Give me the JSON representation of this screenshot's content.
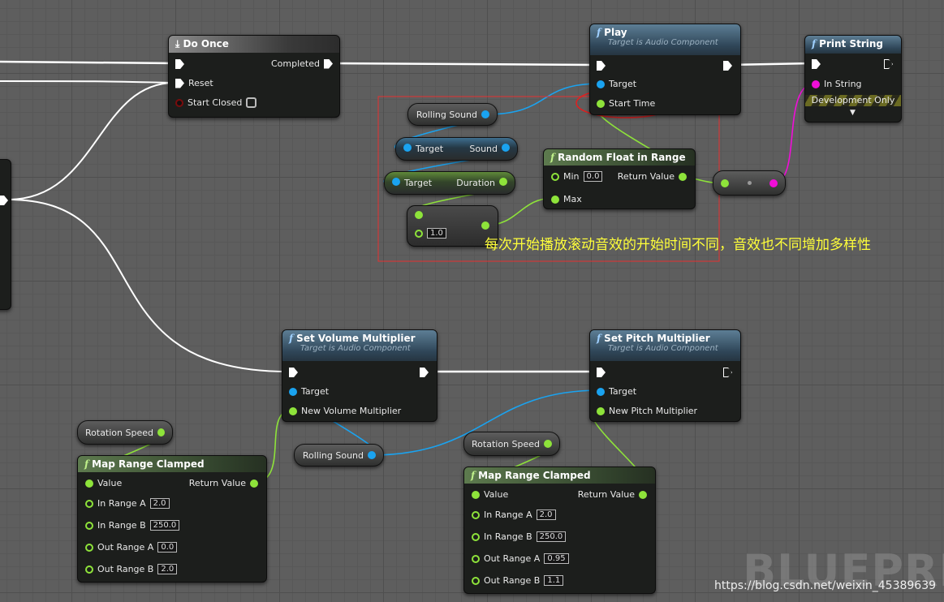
{
  "colors": {
    "exec": "#ffffff",
    "object": "#1aa3f0",
    "float": "#8ee33a",
    "string": "#f00ed8",
    "annotation": "#ffff3a",
    "comment_box": "#e53030"
  },
  "do_once": {
    "title": "Do Once",
    "icon": "macro-icon",
    "completed": "Completed",
    "reset": "Reset",
    "start_closed": "Start Closed"
  },
  "play": {
    "title": "Play",
    "subtitle": "Target is Audio Component",
    "target": "Target",
    "start_time": "Start Time"
  },
  "print_string": {
    "title": "Print String",
    "in_string": "In String",
    "dev_only": "Development Only"
  },
  "rolling_sound_1": "Rolling Sound",
  "get_sound": {
    "target": "Target",
    "sound": "Sound"
  },
  "get_duration": {
    "target": "Target",
    "duration": "Duration"
  },
  "multiply": {
    "value": "1.0"
  },
  "random_float": {
    "title": "Random Float in Range",
    "min": "Min",
    "min_value": "0.0",
    "max": "Max",
    "return_value": "Return Value"
  },
  "annotation": "每次开始播放滚动音效的开始时间不同，音效也不同增加多样性",
  "set_volume": {
    "title": "Set Volume Multiplier",
    "subtitle": "Target is Audio Component",
    "target": "Target",
    "new_value": "New Volume Multiplier"
  },
  "set_pitch": {
    "title": "Set Pitch Multiplier",
    "subtitle": "Target is Audio Component",
    "target": "Target",
    "new_value": "New Pitch Multiplier"
  },
  "rotation_speed_1": "Rotation Speed",
  "rotation_speed_2": "Rotation Speed",
  "rolling_sound_2": "Rolling Sound",
  "map_range_1": {
    "title": "Map Range Clamped",
    "value": "Value",
    "return_value": "Return Value",
    "in_a": "In Range A",
    "in_a_v": "2.0",
    "in_b": "In Range B",
    "in_b_v": "250.0",
    "out_a": "Out Range A",
    "out_a_v": "0.0",
    "out_b": "Out Range B",
    "out_b_v": "2.0"
  },
  "map_range_2": {
    "title": "Map Range Clamped",
    "value": "Value",
    "return_value": "Return Value",
    "in_a": "In Range A",
    "in_a_v": "2.0",
    "in_b": "In Range B",
    "in_b_v": "250.0",
    "out_a": "Out Range A",
    "out_a_v": "0.95",
    "out_b": "Out Range B",
    "out_b_v": "1.1"
  },
  "watermark": "BLUEPRINT",
  "url": "https://blog.csdn.net/weixin_45389639"
}
